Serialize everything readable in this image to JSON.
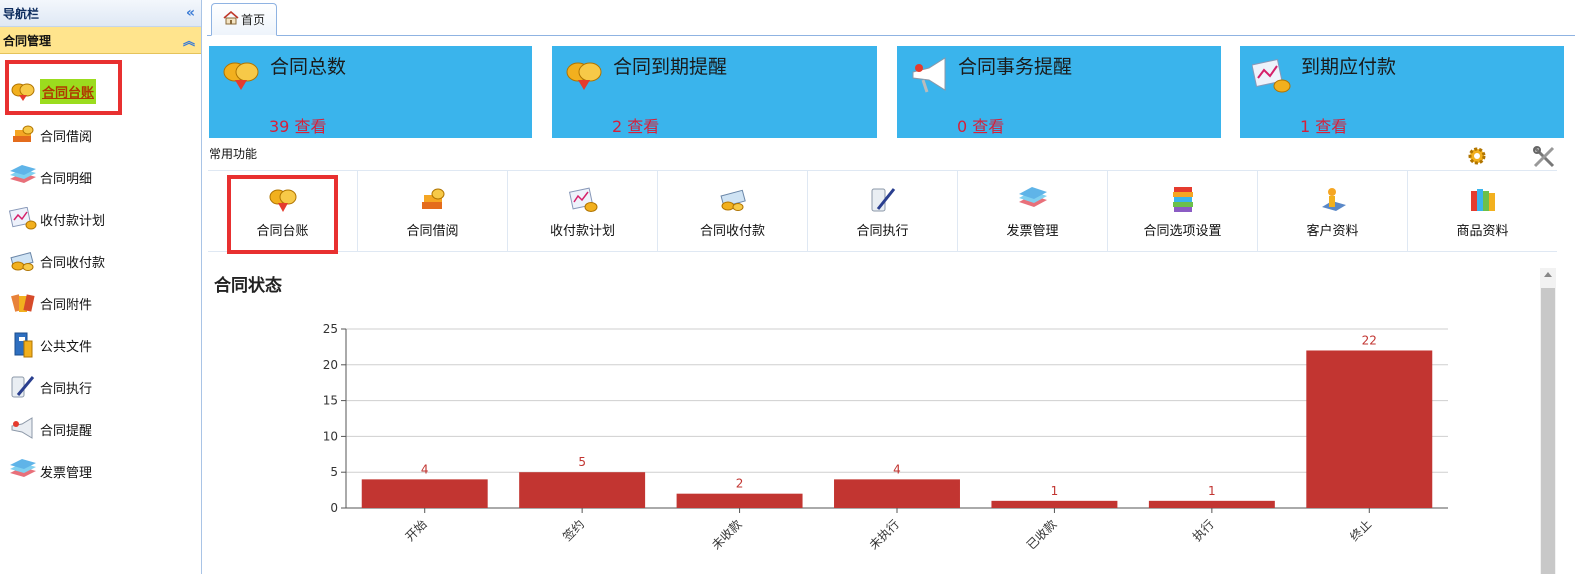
{
  "sidebar": {
    "title": "导航栏",
    "group": "合同管理",
    "items": [
      {
        "label": "合同台账",
        "icon": "coins-icon"
      },
      {
        "label": "合同借阅",
        "icon": "books-icon"
      },
      {
        "label": "合同明细",
        "icon": "stack-icon"
      },
      {
        "label": "收付款计划",
        "icon": "chart-coins-icon"
      },
      {
        "label": "合同收付款",
        "icon": "money-icon"
      },
      {
        "label": "合同附件",
        "icon": "attachment-icon"
      },
      {
        "label": "公共文件",
        "icon": "binder-icon"
      },
      {
        "label": "合同执行",
        "icon": "pen-paper-icon"
      },
      {
        "label": "合同提醒",
        "icon": "megaphone-icon"
      },
      {
        "label": "发票管理",
        "icon": "invoice-icon"
      }
    ]
  },
  "tab": {
    "home_label": "首页"
  },
  "stats": [
    {
      "title": "合同总数",
      "count": "39 查看",
      "icon": "coins-icon"
    },
    {
      "title": "合同到期提醒",
      "count": "2 查看",
      "icon": "coins-icon"
    },
    {
      "title": "合同事务提醒",
      "count": "0 查看",
      "icon": "megaphone-icon"
    },
    {
      "title": "到期应付款",
      "count": "1 查看",
      "icon": "chart-coins-icon"
    }
  ],
  "common": {
    "title": "常用功能",
    "items": [
      {
        "label": "合同台账"
      },
      {
        "label": "合同借阅"
      },
      {
        "label": "收付款计划"
      },
      {
        "label": "合同收付款"
      },
      {
        "label": "合同执行"
      },
      {
        "label": "发票管理"
      },
      {
        "label": "合同选项设置"
      },
      {
        "label": "客户资料"
      },
      {
        "label": "商品资料"
      }
    ]
  },
  "colors": {
    "card": "#3ab4ec",
    "bar": "#c23531",
    "accent": "#e83030"
  },
  "chart_data": {
    "type": "bar",
    "title": "合同状态",
    "categories": [
      "开始",
      "签约",
      "未收款",
      "未执行",
      "已收款",
      "执行",
      "终止"
    ],
    "values": [
      4,
      5,
      2,
      4,
      1,
      1,
      22
    ],
    "ylim": [
      0,
      25
    ],
    "yticks": [
      0,
      5,
      10,
      15,
      20,
      25
    ],
    "grid": true
  }
}
